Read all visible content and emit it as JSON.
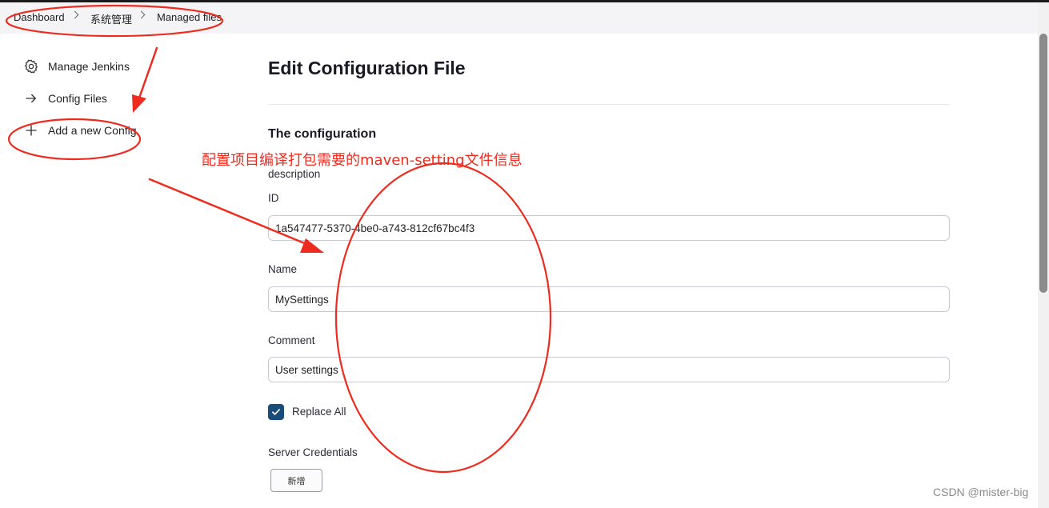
{
  "breadcrumb": {
    "items": [
      "Dashboard",
      "系统管理",
      "Managed files"
    ]
  },
  "sidebar": {
    "items": [
      {
        "label": "Manage Jenkins",
        "icon": "gear-icon"
      },
      {
        "label": "Config Files",
        "icon": "arrow-right-icon"
      },
      {
        "label": "Add a new Config",
        "icon": "plus-icon"
      }
    ]
  },
  "main": {
    "title": "Edit Configuration File",
    "section_title": "The configuration",
    "description_label": "description",
    "id_label": "ID",
    "id_value": "1a547477-5370-4be0-a743-812cf67bc4f3",
    "name_label": "Name",
    "name_value": "MySettings",
    "comment_label": "Comment",
    "comment_value": "User settings",
    "replace_all_label": "Replace All",
    "replace_all_checked": true,
    "server_credentials_label": "Server Credentials",
    "add_button_label": "新增"
  },
  "annotation": {
    "text": "配置项目编译打包需要的maven-setting文件信息",
    "color": "#ee2b1f"
  },
  "watermark": "CSDN @mister-big",
  "colors": {
    "accent": "#1a4c7a",
    "annotation_red": "#ee2b1f"
  }
}
